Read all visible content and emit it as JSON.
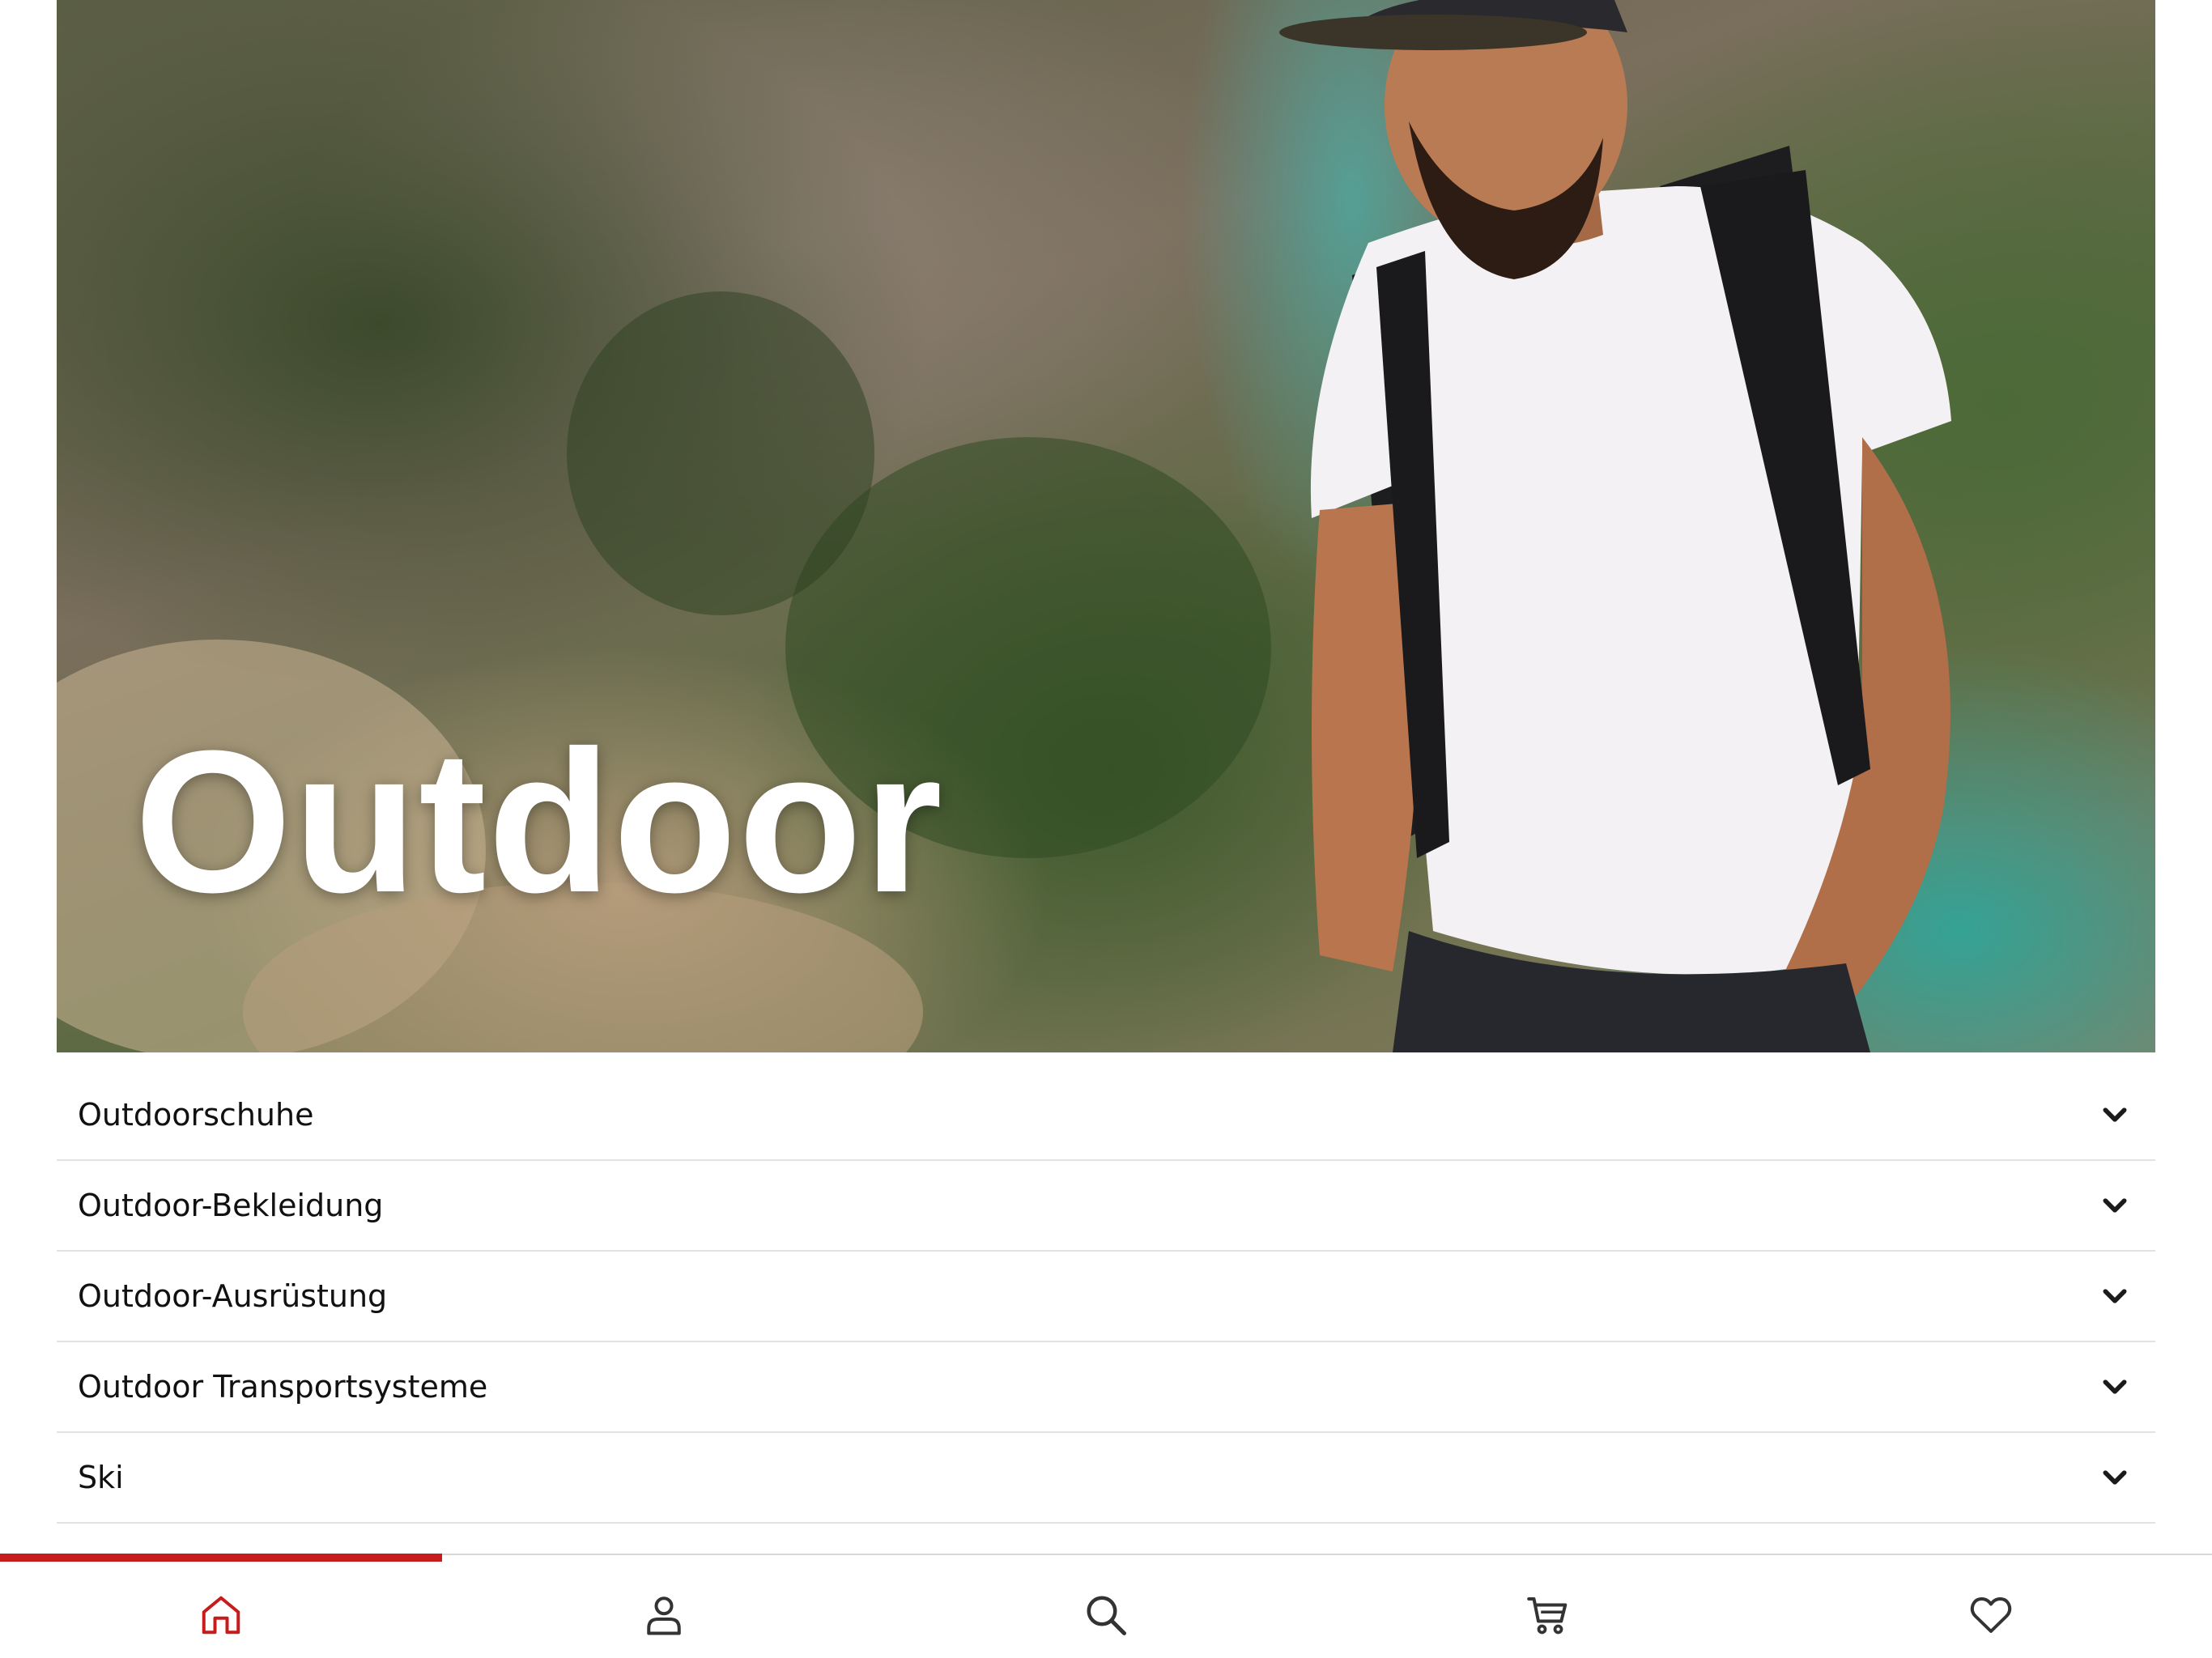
{
  "colors": {
    "accent": "#c81b1b",
    "text": "#111111",
    "divider": "#e2e2e2",
    "icon": "#333333"
  },
  "hero": {
    "title": "Outdoor"
  },
  "categories": [
    {
      "label": "Outdoorschuhe",
      "icon": "chevron-down-icon"
    },
    {
      "label": "Outdoor-Bekleidung",
      "icon": "chevron-down-icon"
    },
    {
      "label": "Outdoor-Ausrüstung",
      "icon": "chevron-down-icon"
    },
    {
      "label": "Outdoor Transportsysteme",
      "icon": "chevron-down-icon"
    },
    {
      "label": "Ski",
      "icon": "chevron-down-icon"
    }
  ],
  "bottom_nav": {
    "active": "home",
    "items": [
      {
        "id": "home",
        "icon": "home-icon"
      },
      {
        "id": "account",
        "icon": "user-icon"
      },
      {
        "id": "search",
        "icon": "search-icon"
      },
      {
        "id": "cart",
        "icon": "cart-icon"
      },
      {
        "id": "wishlist",
        "icon": "heart-icon"
      }
    ]
  }
}
